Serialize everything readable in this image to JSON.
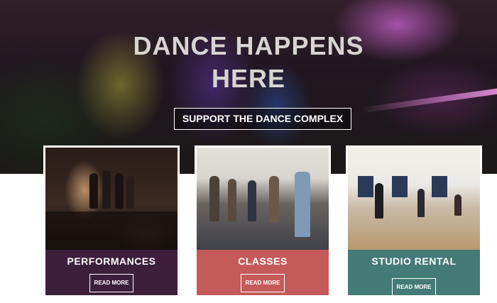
{
  "hero": {
    "title_line1": "DANCE HAPPENS",
    "title_line2": "HERE",
    "support_button": "SUPPORT THE DANCE COMPLEX"
  },
  "cards": [
    {
      "title": "PERFORMANCES",
      "button": "READ MORE",
      "color": "#3d1f3c"
    },
    {
      "title": "CLASSES",
      "button": "READ MORE",
      "color": "#c45a5a"
    },
    {
      "title": "STUDIO RENTAL",
      "button": "READ MORE",
      "color": "#447a78"
    }
  ]
}
